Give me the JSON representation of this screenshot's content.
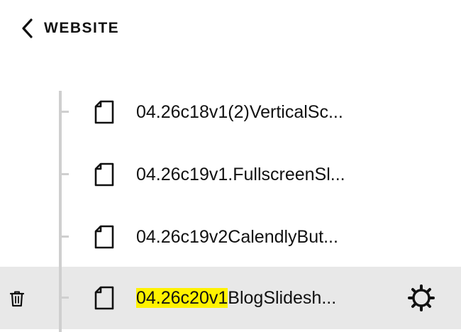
{
  "header": {
    "title": "WEBSITE",
    "back_icon": "chevron-left-icon"
  },
  "pages": [
    {
      "label": "04.26c18v1(2)VerticalSc...",
      "icon": "page-icon"
    },
    {
      "label": "04.26c19v1.FullscreenSl...",
      "icon": "page-icon"
    },
    {
      "label": "04.26c19v2CalendlyBut...",
      "icon": "page-icon"
    }
  ],
  "selected_page": {
    "label_highlight": "04.26c20v1",
    "label_rest": "BlogSlidesh...",
    "icon": "page-icon",
    "actions": [
      "trash-icon",
      "gear-icon"
    ]
  },
  "colors": {
    "highlight": "#fff200",
    "selected_row_bg": "#e8e8e8",
    "tree_line": "#cfcfcf",
    "text": "#111111"
  }
}
